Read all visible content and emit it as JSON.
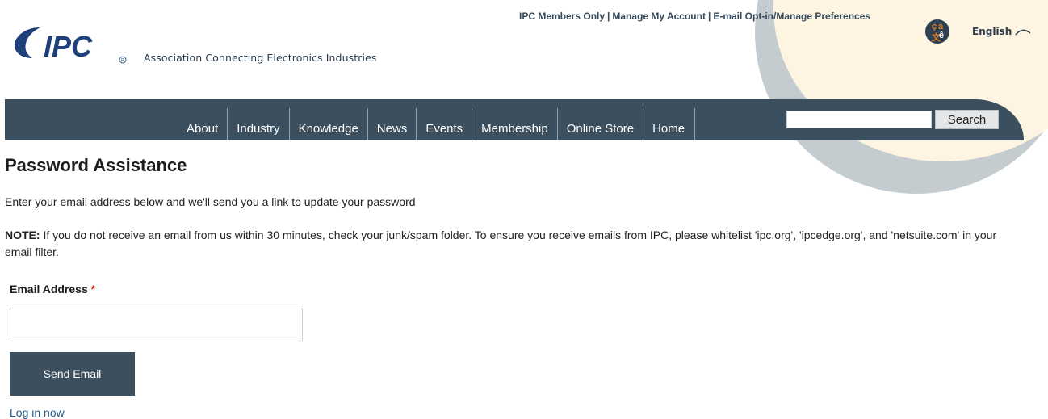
{
  "header": {
    "logo_text": "IPC",
    "tagline": "Association Connecting Electronics Industries",
    "top_links": [
      "IPC Members Only",
      "Manage My Account",
      "E-mail Opt-in/Manage Preferences"
    ],
    "top_link_separator": "|",
    "language": {
      "icon": "language-translate-icon",
      "glyphs": [
        "ç",
        "a",
        "文",
        "ê"
      ],
      "label": "English"
    }
  },
  "nav": {
    "items": [
      "About",
      "Industry",
      "Knowledge",
      "News",
      "Events",
      "Membership",
      "Online Store",
      "Home"
    ],
    "search": {
      "value": "",
      "button_label": "Search"
    }
  },
  "main": {
    "title": "Password Assistance",
    "intro": "Enter your email address below and we'll send you a link to update your password",
    "note_label": "NOTE:",
    "note_text": " If you do not receive an email from us within 30 minutes, check your junk/spam folder. To ensure you receive emails from IPC, please whitelist 'ipc.org', 'ipcedge.org', and 'netsuite.com' in your email filter.",
    "form": {
      "email_label": "Email Address",
      "required_marker": "*",
      "email_value": "",
      "submit_label": "Send Email"
    },
    "login_link": "Log in now"
  },
  "colors": {
    "nav_bg": "#3b4f5e",
    "button_bg": "#3b4f5e",
    "link": "#1f5a8a",
    "required": "#d0342c",
    "logo_blue": "#1d3f7a",
    "decor_cream": "#fdf5e1",
    "decor_gray": "#c5ccd0"
  }
}
